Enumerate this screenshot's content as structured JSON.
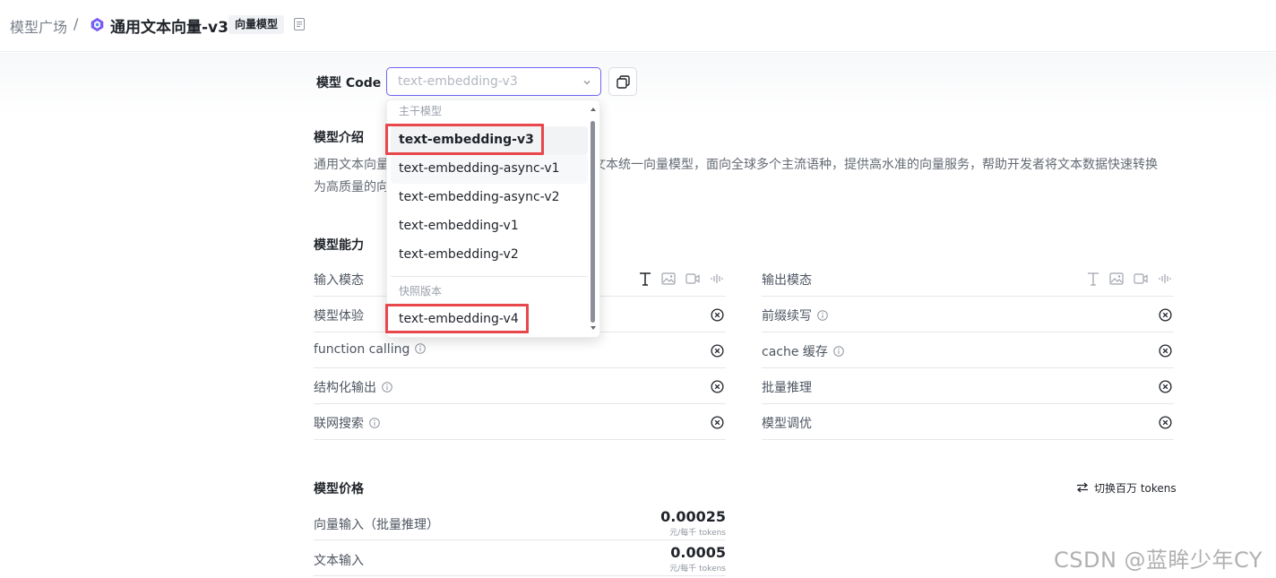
{
  "breadcrumb": {
    "root": "模型广场",
    "separator": "/",
    "title": "通用文本向量-v3",
    "badge": "向量模型"
  },
  "model_code": {
    "label": "模型 Code",
    "placeholder": "text-embedding-v3"
  },
  "dropdown": {
    "group_main": "主干模型",
    "group_snapshot": "快照版本",
    "items": [
      "text-embedding-v3",
      "text-embedding-async-v1",
      "text-embedding-async-v2",
      "text-embedding-v1",
      "text-embedding-v2"
    ],
    "snapshot_items": [
      "text-embedding-v4"
    ],
    "selected": "text-embedding-v3"
  },
  "intro": {
    "title": "模型介绍",
    "text_left": "通用文本向量",
    "text_right": "文本统一向量模型，面向全球多个主流语种，提供高水准的向量服务，帮助开发者将文本数据快速转换",
    "text_line2": "为高质量的向"
  },
  "capabilities": {
    "title": "模型能力",
    "input_modality": "输入模态",
    "output_modality": "输出模态",
    "left": [
      {
        "label": "模型体验",
        "info": false
      },
      {
        "label": "function calling",
        "info": true
      },
      {
        "label": "结构化输出",
        "info": true
      },
      {
        "label": "联网搜索",
        "info": true
      }
    ],
    "right": [
      {
        "label": "前缀续写",
        "info": true
      },
      {
        "label": "cache 缓存",
        "info": true
      },
      {
        "label": "批量推理",
        "info": false
      },
      {
        "label": "模型调优",
        "info": false
      }
    ]
  },
  "pricing": {
    "title": "模型价格",
    "toggle": "切换百万 tokens",
    "rows": [
      {
        "label": "向量输入（批量推理）",
        "value": "0.00025",
        "unit": "元/每千 tokens"
      },
      {
        "label": "文本输入",
        "value": "0.0005",
        "unit": "元/每千 tokens"
      }
    ]
  },
  "watermark": "CSDN @蓝眸少年CY",
  "colors": {
    "accent": "#6f64f5",
    "highlight_box": "#e8474b"
  }
}
